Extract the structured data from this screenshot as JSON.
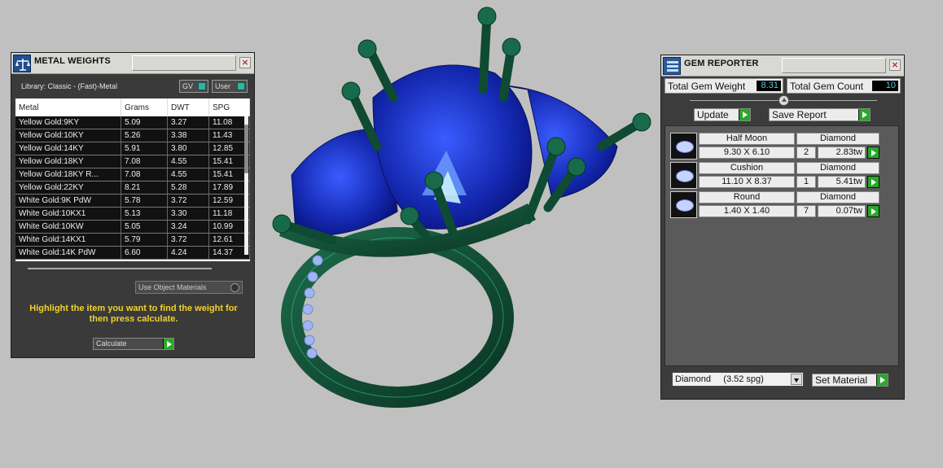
{
  "metal_weights": {
    "title": "METAL WEIGHTS",
    "library_label": "Library: Classic - (Fast)-Metal",
    "toggle_gv": "GV",
    "toggle_user": "User",
    "columns": [
      "Metal",
      "Grams",
      "DWT",
      "SPG"
    ],
    "rows": [
      [
        "Yellow Gold:9KY",
        "5.09",
        "3.27",
        "11.08"
      ],
      [
        "Yellow Gold:10KY",
        "5.26",
        "3.38",
        "11.43"
      ],
      [
        "Yellow Gold:14KY",
        "5.91",
        "3.80",
        "12.85"
      ],
      [
        "Yellow Gold:18KY",
        "7.08",
        "4.55",
        "15.41"
      ],
      [
        "Yellow Gold:18KY R...",
        "7.08",
        "4.55",
        "15.41"
      ],
      [
        "Yellow Gold:22KY",
        "8.21",
        "5.28",
        "17.89"
      ],
      [
        "White Gold:9K PdW",
        "5.78",
        "3.72",
        "12.59"
      ],
      [
        "White Gold:10KX1",
        "5.13",
        "3.30",
        "11.18"
      ],
      [
        "White Gold:10KW",
        "5.05",
        "3.24",
        "10.99"
      ],
      [
        "White Gold:14KX1",
        "5.79",
        "3.72",
        "12.61"
      ],
      [
        "White Gold:14K PdW",
        "6.60",
        "4.24",
        "14.37"
      ]
    ],
    "use_object_materials": "Use Object Materials",
    "hint": "Highlight the item you want to find the weight for then press calculate.",
    "calculate": "Calculate"
  },
  "gem_reporter": {
    "title": "GEM REPORTER",
    "total_weight_label": "Total Gem Weight",
    "total_weight_value": "8.31",
    "total_count_label": "Total Gem Count",
    "total_count_value": "10",
    "update": "Update",
    "save_report": "Save Report",
    "gems": [
      {
        "shape": "Half Moon",
        "material": "Diamond",
        "size": "9.30 X 6.10",
        "count": "2",
        "weight": "2.83tw"
      },
      {
        "shape": "Cushion",
        "material": "Diamond",
        "size": "11.10 X 8.37",
        "count": "1",
        "weight": "5.41tw"
      },
      {
        "shape": "Round",
        "material": "Diamond",
        "size": "1.40 X 1.40",
        "count": "7",
        "weight": "0.07tw"
      }
    ],
    "material_select": "Diamond     (3.52 spg)",
    "set_material": "Set Material"
  },
  "colors": {
    "background": "#c0c0c0",
    "panel": "#3a3a3a",
    "hint": "#f2d22a",
    "metal": "#0f4a33",
    "gem": "#1830b8",
    "go_button": "#28a828"
  }
}
